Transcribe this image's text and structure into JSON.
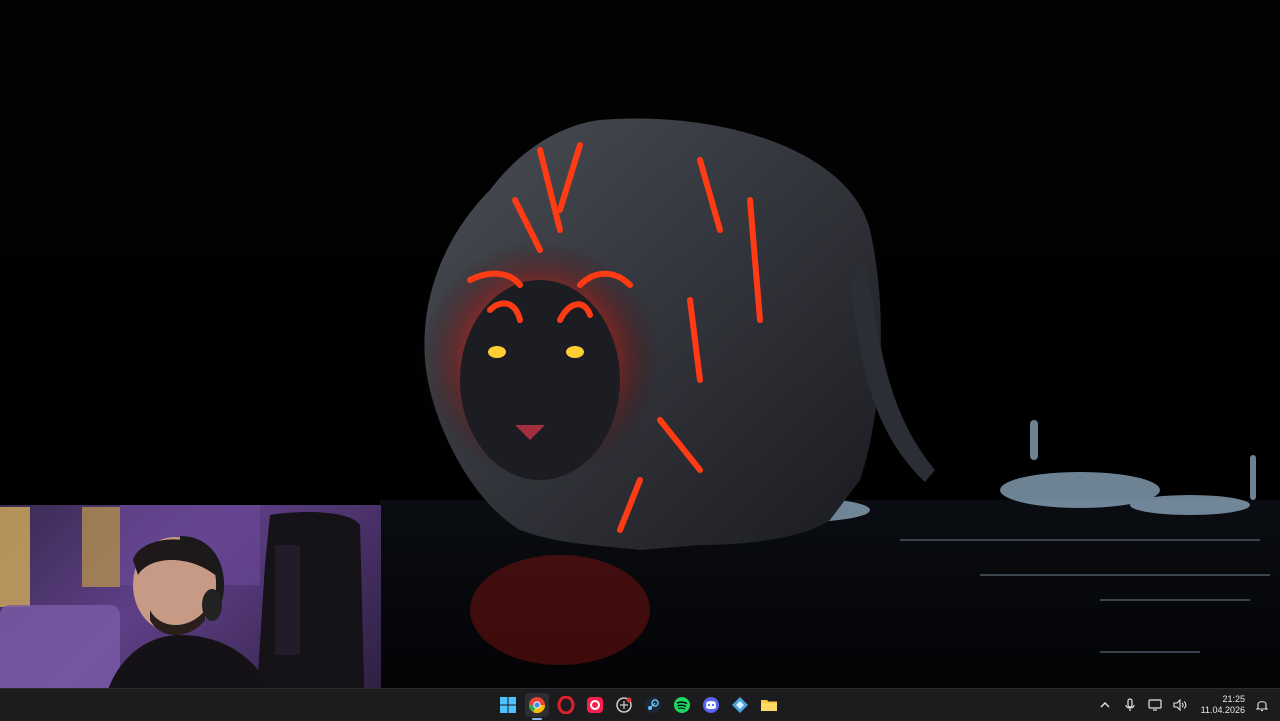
{
  "wallpaper": {
    "subject": "neon-tiger-wallpaper"
  },
  "webcam": {
    "subject": "streamer-webcam-feed"
  },
  "taskbar": {
    "apps": [
      {
        "name": "windows-start-icon",
        "color": "#4cc2ff"
      },
      {
        "name": "chrome-icon",
        "color": "#fbbc05"
      },
      {
        "name": "opera-icon",
        "color": "#e0212b"
      },
      {
        "name": "opera-gx-icon",
        "color": "#fa1e4e"
      },
      {
        "name": "app-icon-unknown",
        "color": "#cccccc"
      },
      {
        "name": "steam-icon",
        "color": "#66c0f4"
      },
      {
        "name": "spotify-icon",
        "color": "#1ed760"
      },
      {
        "name": "discord-icon",
        "color": "#5865f2"
      },
      {
        "name": "app-icon-blue",
        "color": "#4aa3e0"
      },
      {
        "name": "file-explorer-icon",
        "color": "#ffc83d"
      }
    ]
  },
  "tray": {
    "time": "21:25",
    "date": "11.04.2026"
  }
}
